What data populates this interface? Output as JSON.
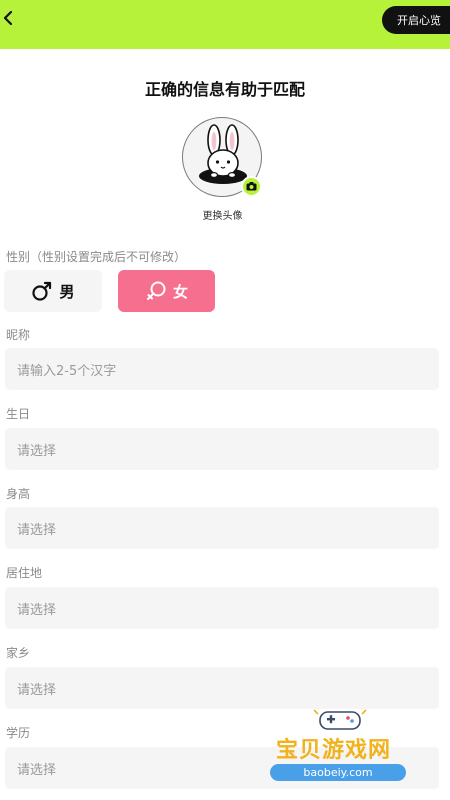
{
  "header": {
    "start_button": "开启心览"
  },
  "page": {
    "title": "正确的信息有助于匹配",
    "change_avatar": "更换头像"
  },
  "gender": {
    "label": "性别（性别设置完成后不可修改）",
    "male": "男",
    "female": "女",
    "selected": "女"
  },
  "fields": {
    "nickname": {
      "label": "昵称",
      "placeholder": "请输入2-5个汉字"
    },
    "birthday": {
      "label": "生日",
      "placeholder": "请选择"
    },
    "height": {
      "label": "身高",
      "placeholder": "请选择"
    },
    "residence": {
      "label": "居住地",
      "placeholder": "请选择"
    },
    "hometown": {
      "label": "家乡",
      "placeholder": "请选择"
    },
    "education": {
      "label": "学历",
      "placeholder": "请选择"
    }
  },
  "watermark": {
    "name": "宝贝游戏网",
    "url": "baobeiy.com"
  },
  "colors": {
    "accent": "#b7f23a",
    "female_selected": "#f76f8e",
    "field_bg": "#f5f5f5"
  },
  "icons": [
    "back-arrow-icon",
    "camera-icon",
    "male-symbol-icon",
    "female-symbol-icon",
    "rabbit-avatar"
  ]
}
